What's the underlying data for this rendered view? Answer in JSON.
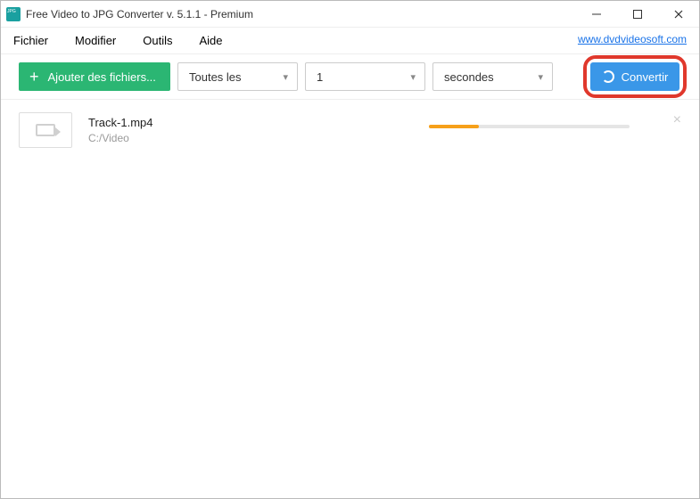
{
  "title": "Free Video to JPG Converter v. 5.1.1 - Premium",
  "menu": {
    "file": "Fichier",
    "edit": "Modifier",
    "tools": "Outils",
    "help": "Aide"
  },
  "site_link": "www.dvdvideosoft.com",
  "toolbar": {
    "add_label": "Ajouter des fichiers...",
    "mode": "Toutes les",
    "value": "1",
    "unit": "secondes",
    "convert_label": "Convertir"
  },
  "files": [
    {
      "name": "Track-1.mp4",
      "path": "C:/Video",
      "progress_percent": 25
    }
  ]
}
